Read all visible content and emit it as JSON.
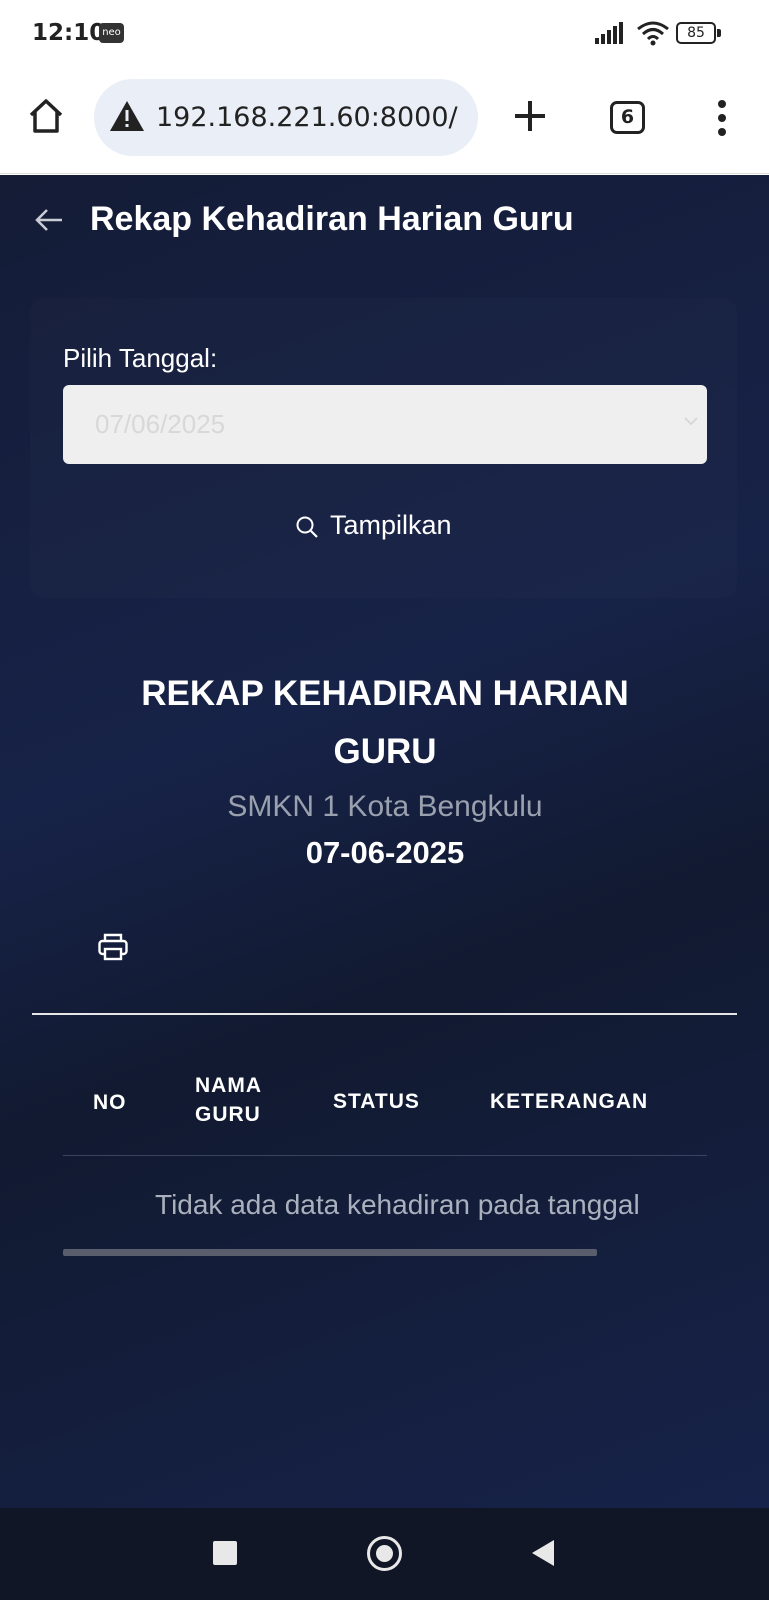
{
  "status_bar": {
    "time": "12:10",
    "badge": "neo",
    "battery": "85",
    "icons": [
      "signal-icon",
      "wifi-icon",
      "battery-icon"
    ]
  },
  "browser": {
    "url": "192.168.221.60:8000/",
    "tab_count": "6",
    "icons": [
      "home-icon",
      "warning-icon",
      "plus-icon",
      "tabs-icon",
      "more-vert-icon"
    ]
  },
  "header": {
    "title": "Rekap Kehadiran Harian Guru"
  },
  "filter": {
    "date_label": "Pilih Tanggal:",
    "date_value": "07/06/2025",
    "show_button_label": "Tampilkan"
  },
  "report": {
    "title": "REKAP KEHADIRAN HARIAN GURU",
    "school": "SMKN 1 Kota Bengkulu",
    "date": "07-06-2025"
  },
  "table": {
    "columns": {
      "no": "NO",
      "nama_line1": "NAMA",
      "nama_line2": "GURU",
      "status": "STATUS",
      "keterangan": "KETERANGAN"
    },
    "empty_message": "Tidak ada data kehadiran pada tanggal"
  },
  "colors": {
    "page_bg": "#141c36",
    "input_bg": "#efefef",
    "muted_text": "#9aa0ae"
  }
}
